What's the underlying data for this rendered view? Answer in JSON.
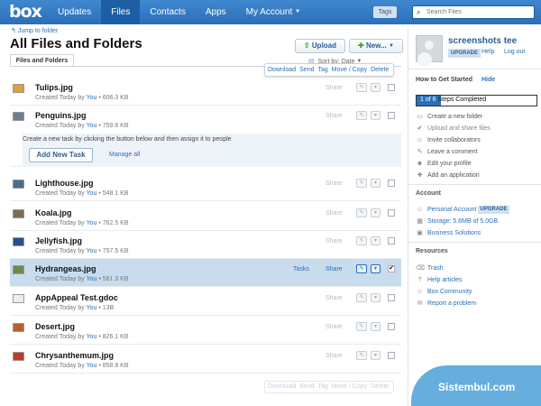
{
  "brand": {
    "logo": "box"
  },
  "nav": [
    {
      "label": "Updates",
      "active": false
    },
    {
      "label": "Files",
      "active": true
    },
    {
      "label": "Contacts",
      "active": false
    },
    {
      "label": "Apps",
      "active": false
    },
    {
      "label": "My Account",
      "active": false
    }
  ],
  "tags_label": "Tags",
  "search": {
    "placeholder": "Search Files"
  },
  "jump_label": "Jump to folder",
  "page_title": "All Files and Folders",
  "buttons": {
    "upload": "Upload",
    "new": "New..."
  },
  "tab_label": "Files and Folders",
  "sort_label": "Sort by: Date",
  "actions": [
    "Download",
    "Send",
    "Tag",
    "Move / Copy",
    "Delete"
  ],
  "files": [
    {
      "name": "Tulips.jpg",
      "meta_prefix": "Created Today by ",
      "owner": "You",
      "size": "606.3 KB",
      "selected": false,
      "color": "#d9a23a"
    },
    {
      "name": "Penguins.jpg",
      "meta_prefix": "Created Today by ",
      "owner": "You",
      "size": "759.6 KB",
      "selected": false,
      "color": "#6b7f96"
    },
    {
      "name": "Lighthouse.jpg",
      "meta_prefix": "Created Today by ",
      "owner": "You",
      "size": "548.1 KB",
      "selected": false,
      "color": "#4a6d8c"
    },
    {
      "name": "Koala.jpg",
      "meta_prefix": "Created Today by ",
      "owner": "You",
      "size": "762.5 KB",
      "selected": false,
      "color": "#7b6b55"
    },
    {
      "name": "Jellyfish.jpg",
      "meta_prefix": "Created Today by ",
      "owner": "You",
      "size": "757.5 KB",
      "selected": false,
      "color": "#2b4c8f"
    },
    {
      "name": "Hydrangeas.jpg",
      "meta_prefix": "Created Today by ",
      "owner": "You",
      "size": "581.3 KB",
      "selected": true,
      "color": "#6d8a4a"
    },
    {
      "name": "AppAppeal Test.gdoc",
      "meta_prefix": "Created Today by ",
      "owner": "You",
      "size": "13B",
      "selected": false,
      "color": "#e8eef6"
    },
    {
      "name": "Desert.jpg",
      "meta_prefix": "Created Today by ",
      "owner": "You",
      "size": "826.1 KB",
      "selected": false,
      "color": "#b5622c"
    },
    {
      "name": "Chrysanthemum.jpg",
      "meta_prefix": "Created Today by ",
      "owner": "You",
      "size": "858.8 KB",
      "selected": false,
      "color": "#c5392c"
    }
  ],
  "row_actions": {
    "share": "Share",
    "tasks": "Tasks"
  },
  "task_panel": {
    "message": "Create a new task by clicking the button below and then assign it to people",
    "add_button": "Add New Task",
    "manage_link": "Manage all"
  },
  "account": {
    "username": "screenshots tee",
    "upgrade": "UPGRADE",
    "help": "Help",
    "logout": "Log out"
  },
  "getting_started": {
    "title": "How to Get Started",
    "hide": "Hide",
    "progress_fraction": 0.2,
    "progress_count": "1 of 6",
    "progress_text": " Steps Completed",
    "steps": [
      {
        "label": "Create a new folder",
        "done": false
      },
      {
        "label": "Upload and share files",
        "done": true
      },
      {
        "label": "Invite collaborators",
        "done": false
      },
      {
        "label": "Leave a comment",
        "done": false
      },
      {
        "label": "Edit your profile",
        "done": false
      },
      {
        "label": "Add an application",
        "done": false
      }
    ]
  },
  "account_section": {
    "title": "Account",
    "plan": "Personal Account",
    "plan_badge": "UPGRADE",
    "storage": "Storage: 5.6MB of 5.0GB",
    "business": "Business Solutions"
  },
  "resources": {
    "title": "Resources",
    "items": [
      "Trash",
      "Help articles",
      "Box Community",
      "Report a problem"
    ]
  },
  "watermark": "Sistembul.com"
}
